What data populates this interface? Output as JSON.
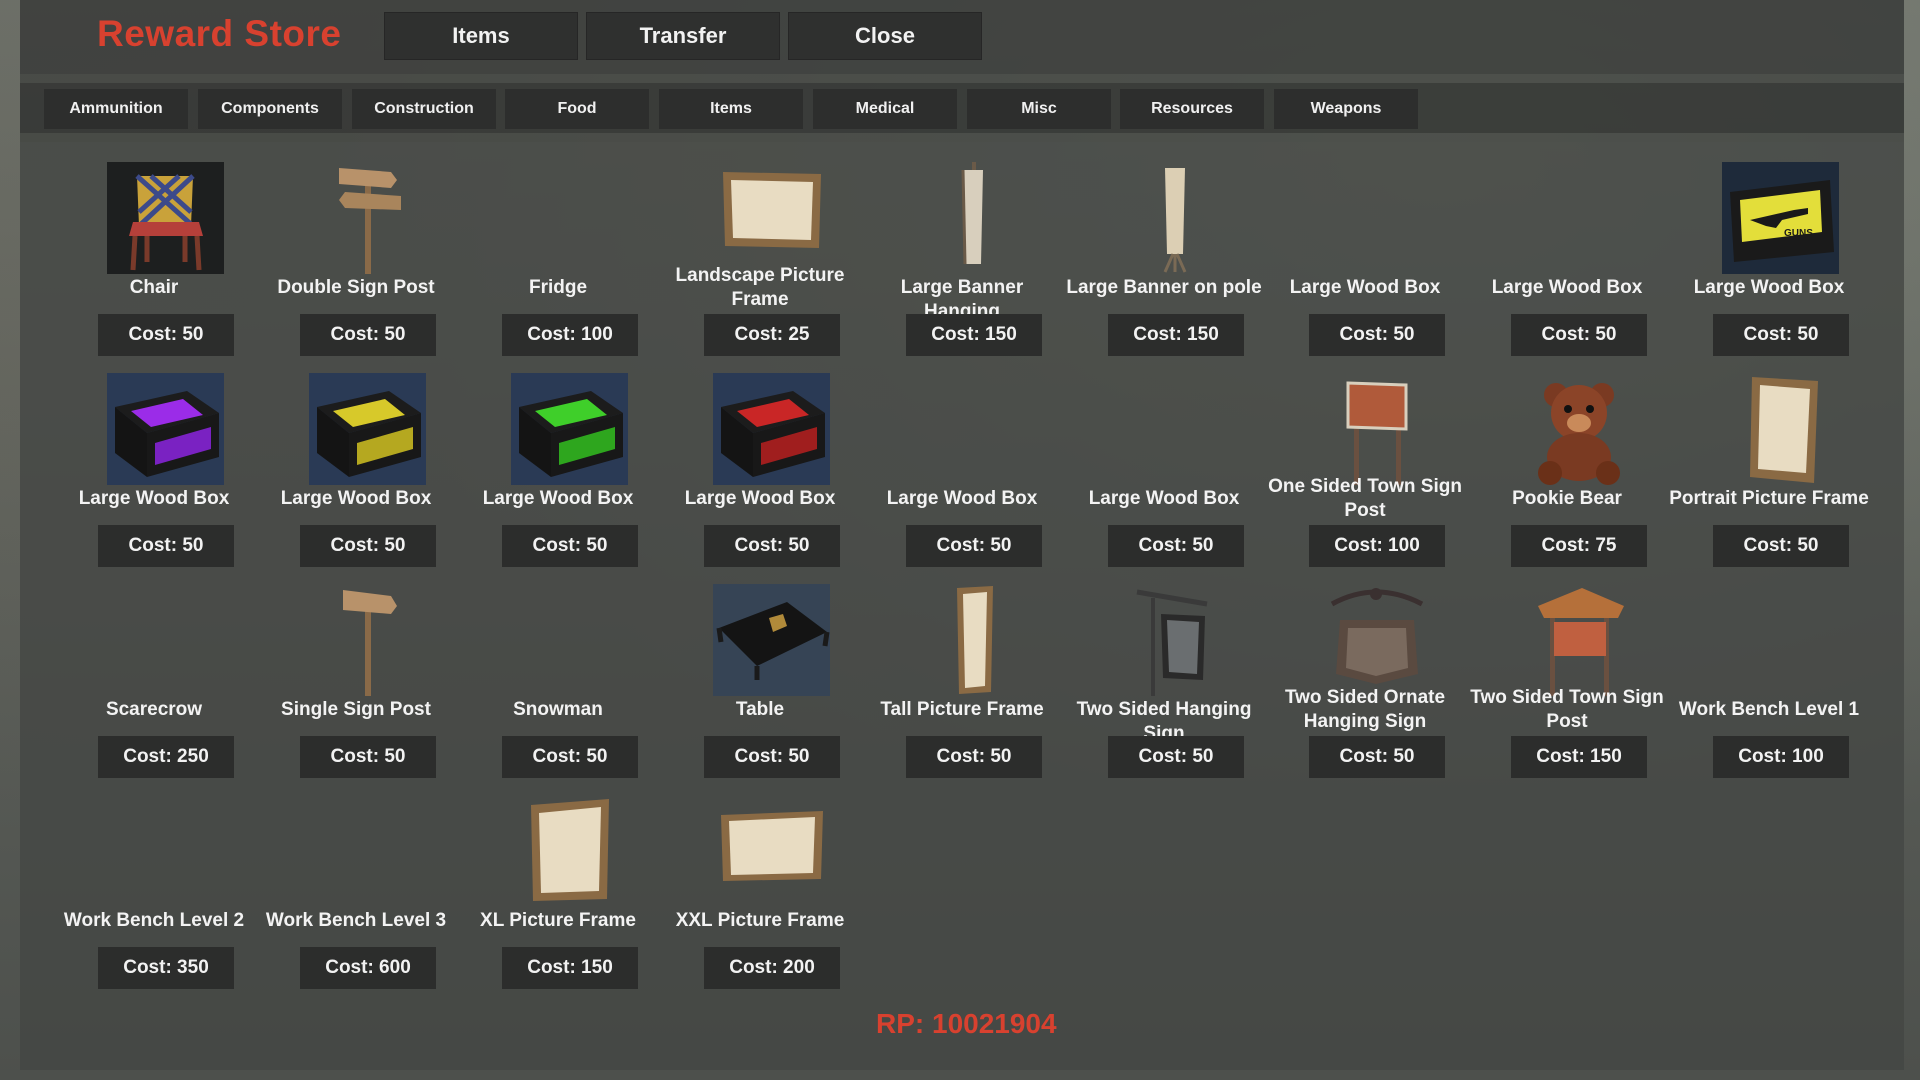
{
  "window": {
    "title": "Reward Store",
    "top_buttons": [
      "Items",
      "Transfer",
      "Close"
    ]
  },
  "categories": [
    "Ammunition",
    "Components",
    "Construction",
    "Food",
    "Items",
    "Medical",
    "Misc",
    "Resources",
    "Weapons"
  ],
  "items": [
    {
      "name": "Chair",
      "cost": "Cost: 50",
      "icon": "chair-icon"
    },
    {
      "name": "Double Sign Post",
      "cost": "Cost: 50",
      "icon": "sign-post-icon"
    },
    {
      "name": "Fridge",
      "cost": "Cost: 100",
      "icon": ""
    },
    {
      "name": "Landscape Picture Frame",
      "cost": "Cost: 25",
      "icon": "landscape-frame-icon"
    },
    {
      "name": "Large Banner Hanging",
      "cost": "Cost: 150",
      "icon": "banner-icon"
    },
    {
      "name": "Large Banner on pole",
      "cost": "Cost: 150",
      "icon": "banner-pole-icon"
    },
    {
      "name": "Large Wood Box",
      "cost": "Cost: 50",
      "icon": ""
    },
    {
      "name": "Large Wood Box",
      "cost": "Cost: 50",
      "icon": ""
    },
    {
      "name": "Large Wood Box",
      "cost": "Cost: 50",
      "icon": "guns-crate-icon"
    },
    {
      "name": "Large Wood Box",
      "cost": "Cost: 50",
      "icon": "purple-crate-icon"
    },
    {
      "name": "Large Wood Box",
      "cost": "Cost: 50",
      "icon": "yellow-crate-icon"
    },
    {
      "name": "Large Wood Box",
      "cost": "Cost: 50",
      "icon": "green-crate-icon"
    },
    {
      "name": "Large Wood Box",
      "cost": "Cost: 50",
      "icon": "red-crate-icon"
    },
    {
      "name": "Large Wood Box",
      "cost": "Cost: 50",
      "icon": ""
    },
    {
      "name": "Large Wood Box",
      "cost": "Cost: 50",
      "icon": ""
    },
    {
      "name": "One Sided Town Sign Post",
      "cost": "Cost: 100",
      "icon": "town-sign-icon"
    },
    {
      "name": "Pookie Bear",
      "cost": "Cost: 75",
      "icon": "teddy-bear-icon"
    },
    {
      "name": "Portrait Picture Frame",
      "cost": "Cost: 50",
      "icon": "portrait-frame-icon"
    },
    {
      "name": "Scarecrow",
      "cost": "Cost: 250",
      "icon": ""
    },
    {
      "name": "Single Sign Post",
      "cost": "Cost: 50",
      "icon": "single-sign-icon"
    },
    {
      "name": "Snowman",
      "cost": "Cost: 50",
      "icon": ""
    },
    {
      "name": "Table",
      "cost": "Cost: 50",
      "icon": "table-icon"
    },
    {
      "name": "Tall Picture Frame",
      "cost": "Cost: 50",
      "icon": "tall-frame-icon"
    },
    {
      "name": "Two Sided Hanging Sign",
      "cost": "Cost: 50",
      "icon": "hanging-sign-icon"
    },
    {
      "name": "Two Sided Ornate Hanging Sign",
      "cost": "Cost: 50",
      "icon": "ornate-sign-icon"
    },
    {
      "name": "Two Sided Town Sign Post",
      "cost": "Cost: 150",
      "icon": "roofed-sign-icon"
    },
    {
      "name": "Work Bench Level 1",
      "cost": "Cost: 100",
      "icon": ""
    },
    {
      "name": "Work Bench Level 2",
      "cost": "Cost: 350",
      "icon": ""
    },
    {
      "name": "Work Bench Level 3",
      "cost": "Cost: 600",
      "icon": ""
    },
    {
      "name": "XL Picture Frame",
      "cost": "Cost: 150",
      "icon": "xl-frame-icon"
    },
    {
      "name": "XXL Picture Frame",
      "cost": "Cost: 200",
      "icon": "xxl-frame-icon"
    }
  ],
  "rp": "RP: 10021904",
  "colors": {
    "accent": "#d8412f",
    "button_bg": "#2c2d2c",
    "text": "#f3f3f3"
  }
}
